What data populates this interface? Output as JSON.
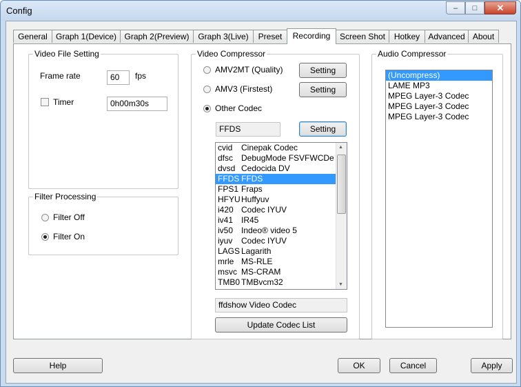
{
  "window": {
    "title": "Config"
  },
  "caption_buttons": {
    "minimize": "–",
    "maximize": "□",
    "close": "✕"
  },
  "tabs": [
    {
      "label": "General"
    },
    {
      "label": "Graph 1(Device)"
    },
    {
      "label": "Graph 2(Preview)"
    },
    {
      "label": "Graph 3(Live)"
    },
    {
      "label": "Preset"
    },
    {
      "label": "Recording",
      "active": true
    },
    {
      "label": "Screen Shot"
    },
    {
      "label": "Hotkey"
    },
    {
      "label": "Advanced"
    },
    {
      "label": "About"
    }
  ],
  "video_file": {
    "legend": "Video File Setting",
    "frame_rate_label": "Frame rate",
    "frame_rate_value": "60",
    "fps_label": "fps",
    "timer_label": "Timer",
    "timer_checked": false,
    "timer_value": "0h00m30s"
  },
  "filter": {
    "legend": "Filter Processing",
    "off_label": "Filter Off",
    "on_label": "Filter On",
    "selected": "on"
  },
  "video_compressor": {
    "legend": "Video Compressor",
    "options": [
      {
        "label": "AMV2MT (Quality)",
        "button": "Setting",
        "selected": false
      },
      {
        "label": "AMV3 (Firstest)",
        "button": "Setting",
        "selected": false
      },
      {
        "label": "Other Codec",
        "selected": true
      }
    ],
    "codec_field": "FFDS",
    "codec_setting": "Setting",
    "codecs": [
      {
        "code": "cvid",
        "name": "Cinepak Codec"
      },
      {
        "code": "dfsc",
        "name": "DebugMode FSVFWCDe"
      },
      {
        "code": "dvsd",
        "name": "Cedocida DV"
      },
      {
        "code": "FFDS",
        "name": "FFDS",
        "selected": true
      },
      {
        "code": "FPS1",
        "name": "Fraps"
      },
      {
        "code": "HFYU",
        "name": "Huffyuv"
      },
      {
        "code": "i420",
        "name": "Codec IYUV"
      },
      {
        "code": "iv41",
        "name": "IR45"
      },
      {
        "code": "iv50",
        "name": "Indeo® video 5"
      },
      {
        "code": "iyuv",
        "name": "Codec IYUV"
      },
      {
        "code": "LAGS",
        "name": "Lagarith"
      },
      {
        "code": "mrle",
        "name": "MS-RLE"
      },
      {
        "code": "msvc",
        "name": "MS-CRAM"
      },
      {
        "code": "TMB0",
        "name": "TMBvcm32"
      }
    ],
    "codec_description": "ffdshow Video Codec",
    "update_button": "Update Codec List"
  },
  "audio_compressor": {
    "legend": "Audio Compressor",
    "items": [
      {
        "label": "(Uncompress)",
        "selected": true
      },
      {
        "label": "LAME MP3"
      },
      {
        "label": "MPEG Layer-3 Codec"
      },
      {
        "label": "MPEG Layer-3 Codec"
      },
      {
        "label": "MPEG Layer-3 Codec"
      }
    ]
  },
  "footer": {
    "help": "Help",
    "ok": "OK",
    "cancel": "Cancel",
    "apply": "Apply"
  },
  "colors": {
    "selection": "#3399ff",
    "title_bg": "#c9dbef",
    "close_btn": "#c7432a"
  }
}
